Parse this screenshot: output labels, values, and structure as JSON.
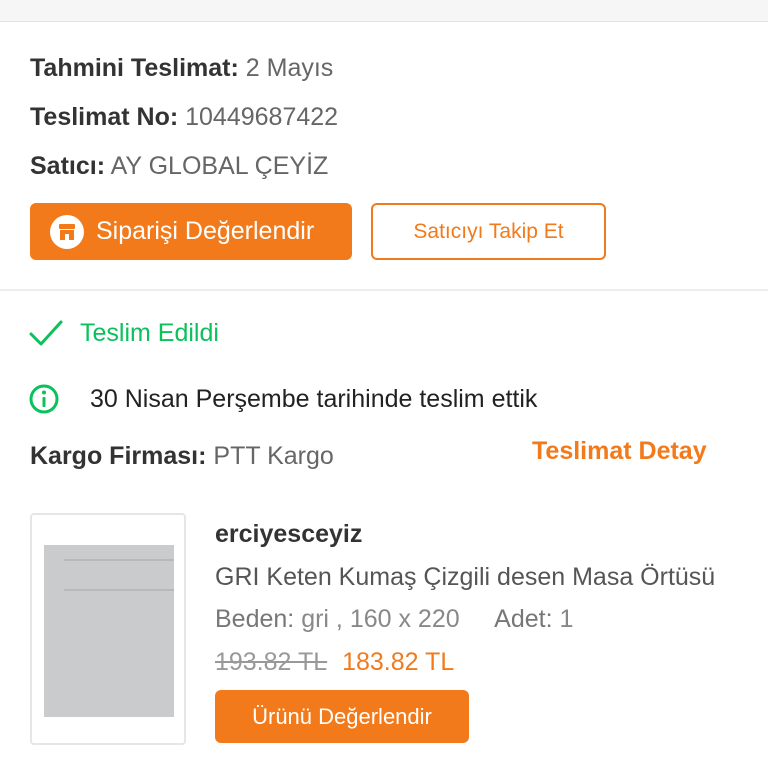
{
  "delivery_info": {
    "estimated_label": "Tahmini Teslimat:",
    "estimated_value": "2 Mayıs",
    "number_label": "Teslimat No:",
    "number_value": "10449687422",
    "seller_label": "Satıcı:",
    "seller_value": "AY GLOBAL ÇEYİZ"
  },
  "actions": {
    "rate_order_label": "Siparişi Değerlendir",
    "rate_order_icon": "store-icon",
    "follow_seller_label": "Satıcıyı Takip Et"
  },
  "shipment": {
    "status_icon": "check-icon",
    "status": "Teslim Edildi",
    "note_icon": "info-icon",
    "note": "30 Nisan Perşembe tarihinde teslim ettik",
    "cargo_label": "Kargo Firması:",
    "cargo_value": "PTT Kargo",
    "detail_link": "Teslimat Detay"
  },
  "product": {
    "seller": "erciyesceyiz",
    "name": "GRI Keten Kumaş Çizgili desen Masa Örtüsü",
    "size_label": "Beden:",
    "size_value": "gri , 160 x 220",
    "qty_label": "Adet:",
    "qty_value": "1",
    "old_price": "193.82 TL",
    "new_price": "183.82 TL",
    "rate_label": "Ürünü Değerlendir"
  },
  "colors": {
    "accent": "#f27a1a",
    "success": "#0bc15c"
  }
}
